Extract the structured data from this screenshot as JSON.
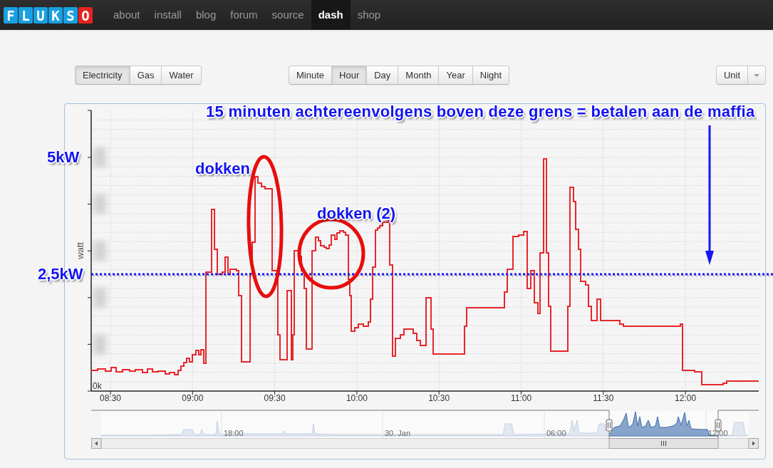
{
  "navbar": {
    "logo": [
      {
        "char": "F",
        "color": "#1a9fe0"
      },
      {
        "char": "L",
        "color": "#1a9fe0"
      },
      {
        "char": "U",
        "color": "#1a9fe0"
      },
      {
        "char": "K",
        "color": "#1a9fe0"
      },
      {
        "char": "S",
        "color": "#1a9fe0"
      },
      {
        "char": "O",
        "color": "#e5231f"
      }
    ],
    "items": [
      {
        "label": "about",
        "selected": false
      },
      {
        "label": "install",
        "selected": false
      },
      {
        "label": "blog",
        "selected": false
      },
      {
        "label": "forum",
        "selected": false
      },
      {
        "label": "source",
        "selected": false
      },
      {
        "label": "dash",
        "selected": true
      },
      {
        "label": "shop",
        "selected": false
      }
    ]
  },
  "energy_types": [
    {
      "label": "Electricity",
      "selected": true
    },
    {
      "label": "Gas",
      "selected": false
    },
    {
      "label": "Water",
      "selected": false
    }
  ],
  "periods": [
    {
      "label": "Minute",
      "selected": false
    },
    {
      "label": "Hour",
      "selected": true
    },
    {
      "label": "Day",
      "selected": false
    },
    {
      "label": "Month",
      "selected": false
    },
    {
      "label": "Year",
      "selected": false
    },
    {
      "label": "Night",
      "selected": false
    }
  ],
  "unit_dropdown": {
    "label": "Unit"
  },
  "chart": {
    "ylabel": "watt",
    "y_tick": "0k",
    "x_ticks": [
      "08:30",
      "09:00",
      "09:30",
      "10:00",
      "10:30",
      "11:00",
      "11:30",
      "12:00"
    ],
    "navigator_labels": [
      "18:00",
      "30. Jan",
      "06:00",
      "12:00"
    ]
  },
  "annotations": {
    "headline": "15 minuten achtereenvolgens boven deze grens = betalen aan de maffia",
    "level_marks": [
      {
        "label": "5kW"
      },
      {
        "label": "2,5kW"
      }
    ],
    "callouts": [
      {
        "label": "dokken"
      },
      {
        "label": "dokken (2)"
      }
    ]
  }
}
